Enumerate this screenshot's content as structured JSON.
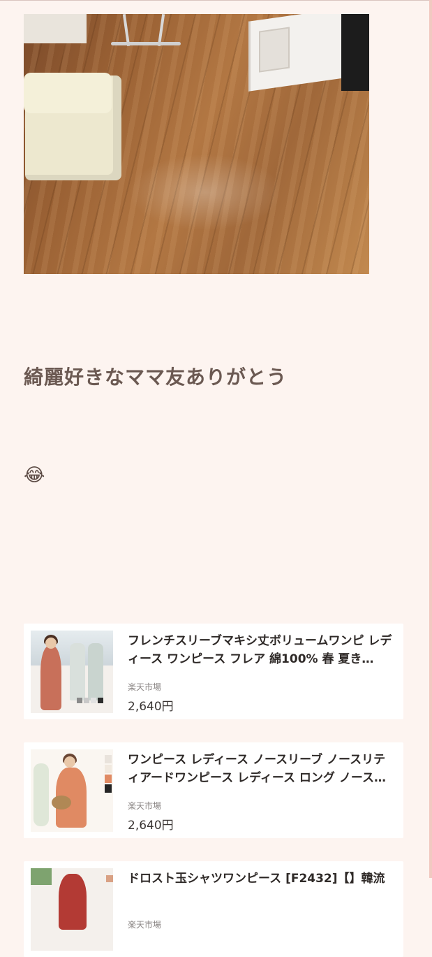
{
  "post": {
    "photo_alt": "wooden floor photo",
    "heading": "綺麗好きなママ友ありがとう",
    "emoji": "😂"
  },
  "products": [
    {
      "title": "フレンチスリーブマキシ丈ボリュームワンピ レディース ワンピース フレア 綿100% 春 夏き…",
      "shop": "楽天市場",
      "price": "2,640円"
    },
    {
      "title": "ワンピース レディース ノースリーブ ノースリティアードワンピース レディース ロング ノース…",
      "shop": "楽天市場",
      "price": "2,640円"
    },
    {
      "title": "ドロスト玉シャツワンピース [F2432]【】韓流",
      "shop": "楽天市場",
      "price": ""
    }
  ],
  "colors": {
    "background": "#fdf4f0",
    "heading": "#6b5952",
    "card": "#ffffff",
    "dress_terracotta": "#c8705a"
  }
}
